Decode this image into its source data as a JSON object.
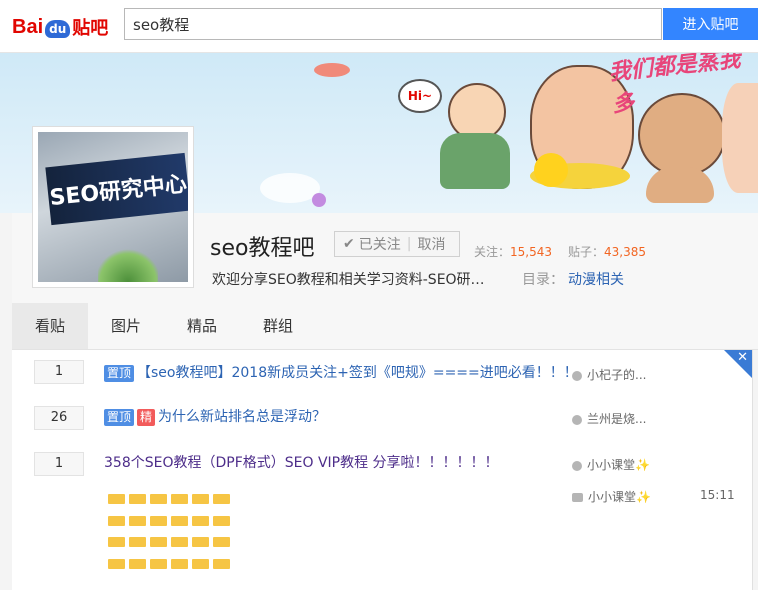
{
  "search": {
    "logo_bai": "Bai",
    "logo_du": "du",
    "logo_tieba": "贴吧",
    "query": "seo教程",
    "button": "进入贴吧"
  },
  "banner": {
    "hi": "Hi~",
    "slogan": "我们都是蒸我多"
  },
  "forum": {
    "name": "seo教程吧",
    "avatar_text": "SEO研究中心",
    "follow_label": "已关注",
    "unfollow_label": "取消",
    "followers_label": "关注：",
    "followers": "15,543",
    "posts_label": "贴子：",
    "posts": "43,385",
    "description": "欢迎分享SEO教程和相关学习资料-SEO研…",
    "dir_label": "目录：",
    "dir_value": "动漫相关"
  },
  "tabs": [
    "看贴",
    "图片",
    "精品",
    "群组"
  ],
  "threads": [
    {
      "replies": "1",
      "badges": [
        "置顶"
      ],
      "title": "【seo教程吧】2018新成员关注+签到《吧规》====进吧必看！！！",
      "author": "小杞子的..."
    },
    {
      "replies": "26",
      "badges": [
        "置顶",
        "精"
      ],
      "title": "为什么新站排名总是浮动？",
      "author": "兰州是烧..."
    },
    {
      "replies": "1",
      "badges": [],
      "title": "358个SEO教程（DPF格式）SEO VIP教程 分享啦！！！！！！",
      "author": "小小课堂✨",
      "last_reply": "小小课堂✨",
      "time": "15:11"
    }
  ],
  "colors": {
    "accent": "#3385ff",
    "brand_red": "#e10601",
    "link": "#2d64b3",
    "count": "#f26522"
  },
  "icons": [
    "check-icon",
    "user-icon",
    "reply-icon",
    "close-icon",
    "folder-icon"
  ]
}
